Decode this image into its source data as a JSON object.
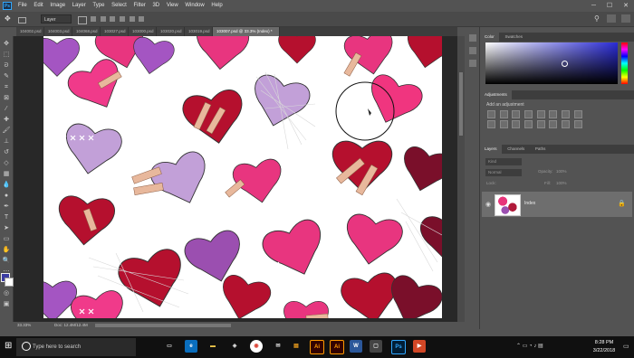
{
  "app": {
    "logo": "Ps",
    "menus": [
      "File",
      "Edit",
      "Image",
      "Layer",
      "Type",
      "Select",
      "Filter",
      "3D",
      "View",
      "Window",
      "Help"
    ],
    "window_controls": [
      "─",
      "☐",
      "✕"
    ]
  },
  "options_bar": {
    "select_value": "Layer"
  },
  "tabs": [
    {
      "label": "104002.psd",
      "active": false
    },
    {
      "label": "104003.psd",
      "active": false
    },
    {
      "label": "104068.psd",
      "active": false
    },
    {
      "label": "103027.psd",
      "active": false
    },
    {
      "label": "103000.psd",
      "active": false
    },
    {
      "label": "103020.psd",
      "active": false
    },
    {
      "label": "103019.psd",
      "active": false
    },
    {
      "label": "103007.psd @ 33.3% (Index) *",
      "active": true
    }
  ],
  "status": {
    "zoom": "33.33%",
    "doc": "Doc: 12.4M/12.4M"
  },
  "color_panel": {
    "tabs": [
      "Color",
      "Swatches"
    ],
    "fg_color": "#3c3da3"
  },
  "adjustments_panel": {
    "title": "Adjustments",
    "subtitle": "Add an adjustment"
  },
  "layers_panel": {
    "tabs": [
      "Layers",
      "Channels",
      "Paths"
    ],
    "filter_label": "Kind",
    "blend_mode": "Normal",
    "opacity_label": "Opacity:",
    "opacity_value": "100%",
    "lock_label": "Lock:",
    "fill_label": "Fill:",
    "fill_value": "100%",
    "layer_name": "Index"
  },
  "taskbar": {
    "search_placeholder": "Type here to search",
    "time": "8:28 PM",
    "date": "3/22/2018"
  },
  "colors": {
    "hot_pink": "#f0357f",
    "crimson": "#b5102e",
    "purple": "#a455c2",
    "lavender": "#c2a0d8",
    "dark_red": "#7a0f2a",
    "bandage": "#e8b89c"
  }
}
